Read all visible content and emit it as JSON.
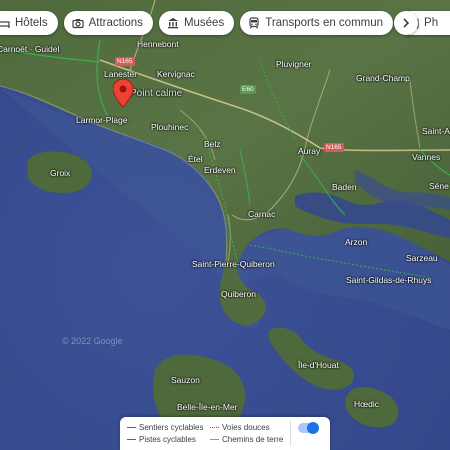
{
  "filter_chips": [
    {
      "label": "Hôtels",
      "icon": "bed-icon"
    },
    {
      "label": "Attractions",
      "icon": "camera-icon"
    },
    {
      "label": "Musées",
      "icon": "museum-icon"
    },
    {
      "label": "Transports en commun",
      "icon": "transit-icon"
    },
    {
      "label": "Ph",
      "icon": "pharmacy-icon"
    }
  ],
  "places": {
    "carnoet": "Carnoët",
    "guidel": "Guidel",
    "hennebont": "Hennebont",
    "lanester": "Lanester",
    "kervignac": "Kervignac",
    "pluvigner": "Pluvigner",
    "grand_champ": "Grand-Champ",
    "point_calme": "Point calme",
    "larmor_plage": "Larmor-Plage",
    "plouhinec": "Plouhinec",
    "saint_av": "Saint-Av",
    "belz": "Belz",
    "auray": "Auray",
    "vannes": "Vannes",
    "sene": "Séne",
    "groix": "Groix",
    "erdeven": "Erdeven",
    "baden": "Baden",
    "carnac": "Carnac",
    "arzon": "Arzon",
    "sarzeau": "Sarzeau",
    "saint_pierre_quiberon": "Saint-Pierre-Quiberon",
    "saint_gildas": "Saint-Gildas-de-Rhuys",
    "quiberon": "Quiberon",
    "ile_d_houat": "Île-d'Houat",
    "sauzon": "Sauzon",
    "belle_ile": "Belle-Île-en-Mer",
    "hoedic": "Hœdic"
  },
  "roads": {
    "n165_west": "N165",
    "e60": "E60",
    "n165_east": "N165"
  },
  "copyright": "© 2022 Google",
  "legend": {
    "items": [
      {
        "label": "Sentiers cyclables",
        "color": "#1e8e3e",
        "style": "solid"
      },
      {
        "label": "Voies douces",
        "color": "#1e8e3e",
        "style": "dotted"
      },
      {
        "label": "Pistes cyclables",
        "color": "#1e8e3e",
        "style": "solid"
      },
      {
        "label": "Chemins de terre",
        "color": "#c5922f",
        "style": "solid"
      }
    ],
    "toggle_on": true
  },
  "colors": {
    "sea": "#3a4d8f",
    "land": "#4c6a3a",
    "pin": "#ea4335",
    "accent": "#1a73e8"
  }
}
